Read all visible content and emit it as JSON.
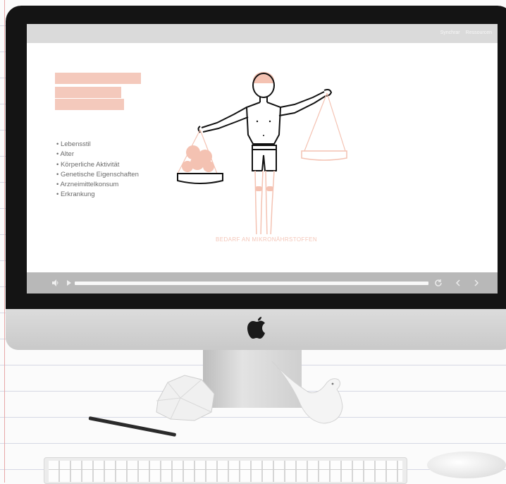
{
  "topbar": {
    "nav": [
      "Synchrar",
      "Ressourcen"
    ]
  },
  "content": {
    "bullets": [
      "Lebensstil",
      "Alter",
      "Körperliche Aktivität",
      "Genetische Eigenschaften",
      "Arzneimittelkonsum",
      "Erkrankung"
    ],
    "caption": "BEDARF AN MIKRONÄHRSTOFFEN"
  },
  "player": {
    "icons": [
      "volume-icon",
      "play-icon",
      "replay-icon",
      "previous-icon",
      "next-icon"
    ],
    "progress_fraction": 1.0
  },
  "colors": {
    "accent": "#f4c9bc",
    "caption": "#f4c6b8",
    "controls_bar": "#b8b8b8",
    "topbar": "#dadada"
  }
}
